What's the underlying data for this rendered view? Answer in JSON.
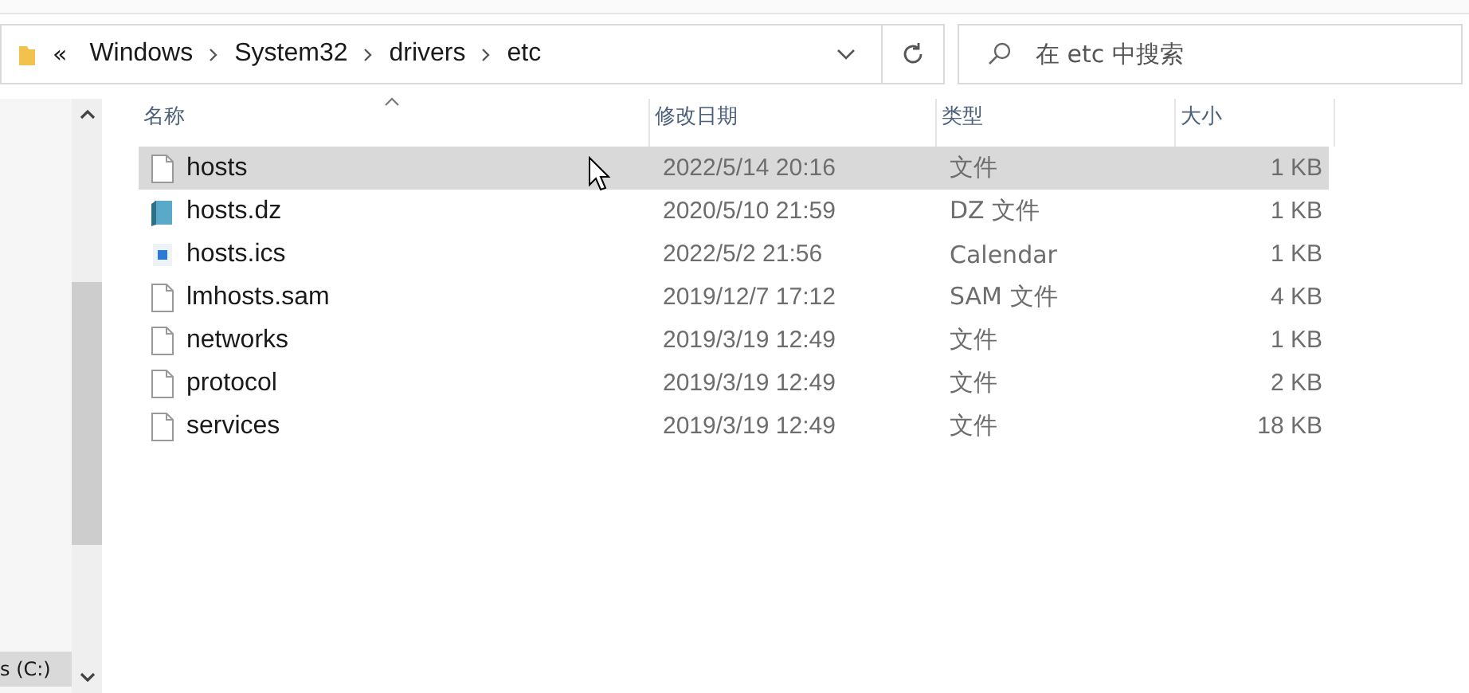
{
  "address_bar": {
    "overflow": "«",
    "crumbs": [
      "Windows",
      "System32",
      "drivers",
      "etc"
    ]
  },
  "search": {
    "placeholder": "在 etc 中搜索"
  },
  "nav_pane": {
    "items": [
      {
        "label": "s (C:)",
        "selected": true
      }
    ]
  },
  "table": {
    "columns": [
      "名称",
      "修改日期",
      "类型",
      "大小"
    ],
    "rows": [
      {
        "name": "hosts",
        "modified": "2022/5/14 20:16",
        "type": "文件",
        "size": "1 KB",
        "kind": "file",
        "selected": true
      },
      {
        "name": "hosts.dz",
        "modified": "2020/5/10 21:59",
        "type": "DZ 文件",
        "size": "1 KB",
        "kind": "notepad",
        "selected": false
      },
      {
        "name": "hosts.ics",
        "modified": "2022/5/2 21:56",
        "type": "Calendar",
        "size": "1 KB",
        "kind": "calendar",
        "selected": false
      },
      {
        "name": "lmhosts.sam",
        "modified": "2019/12/7 17:12",
        "type": "SAM 文件",
        "size": "4 KB",
        "kind": "file",
        "selected": false
      },
      {
        "name": "networks",
        "modified": "2019/3/19 12:49",
        "type": "文件",
        "size": "1 KB",
        "kind": "file",
        "selected": false
      },
      {
        "name": "protocol",
        "modified": "2019/3/19 12:49",
        "type": "文件",
        "size": "2 KB",
        "kind": "file",
        "selected": false
      },
      {
        "name": "services",
        "modified": "2019/3/19 12:49",
        "type": "文件",
        "size": "18 KB",
        "kind": "file",
        "selected": false
      }
    ]
  }
}
